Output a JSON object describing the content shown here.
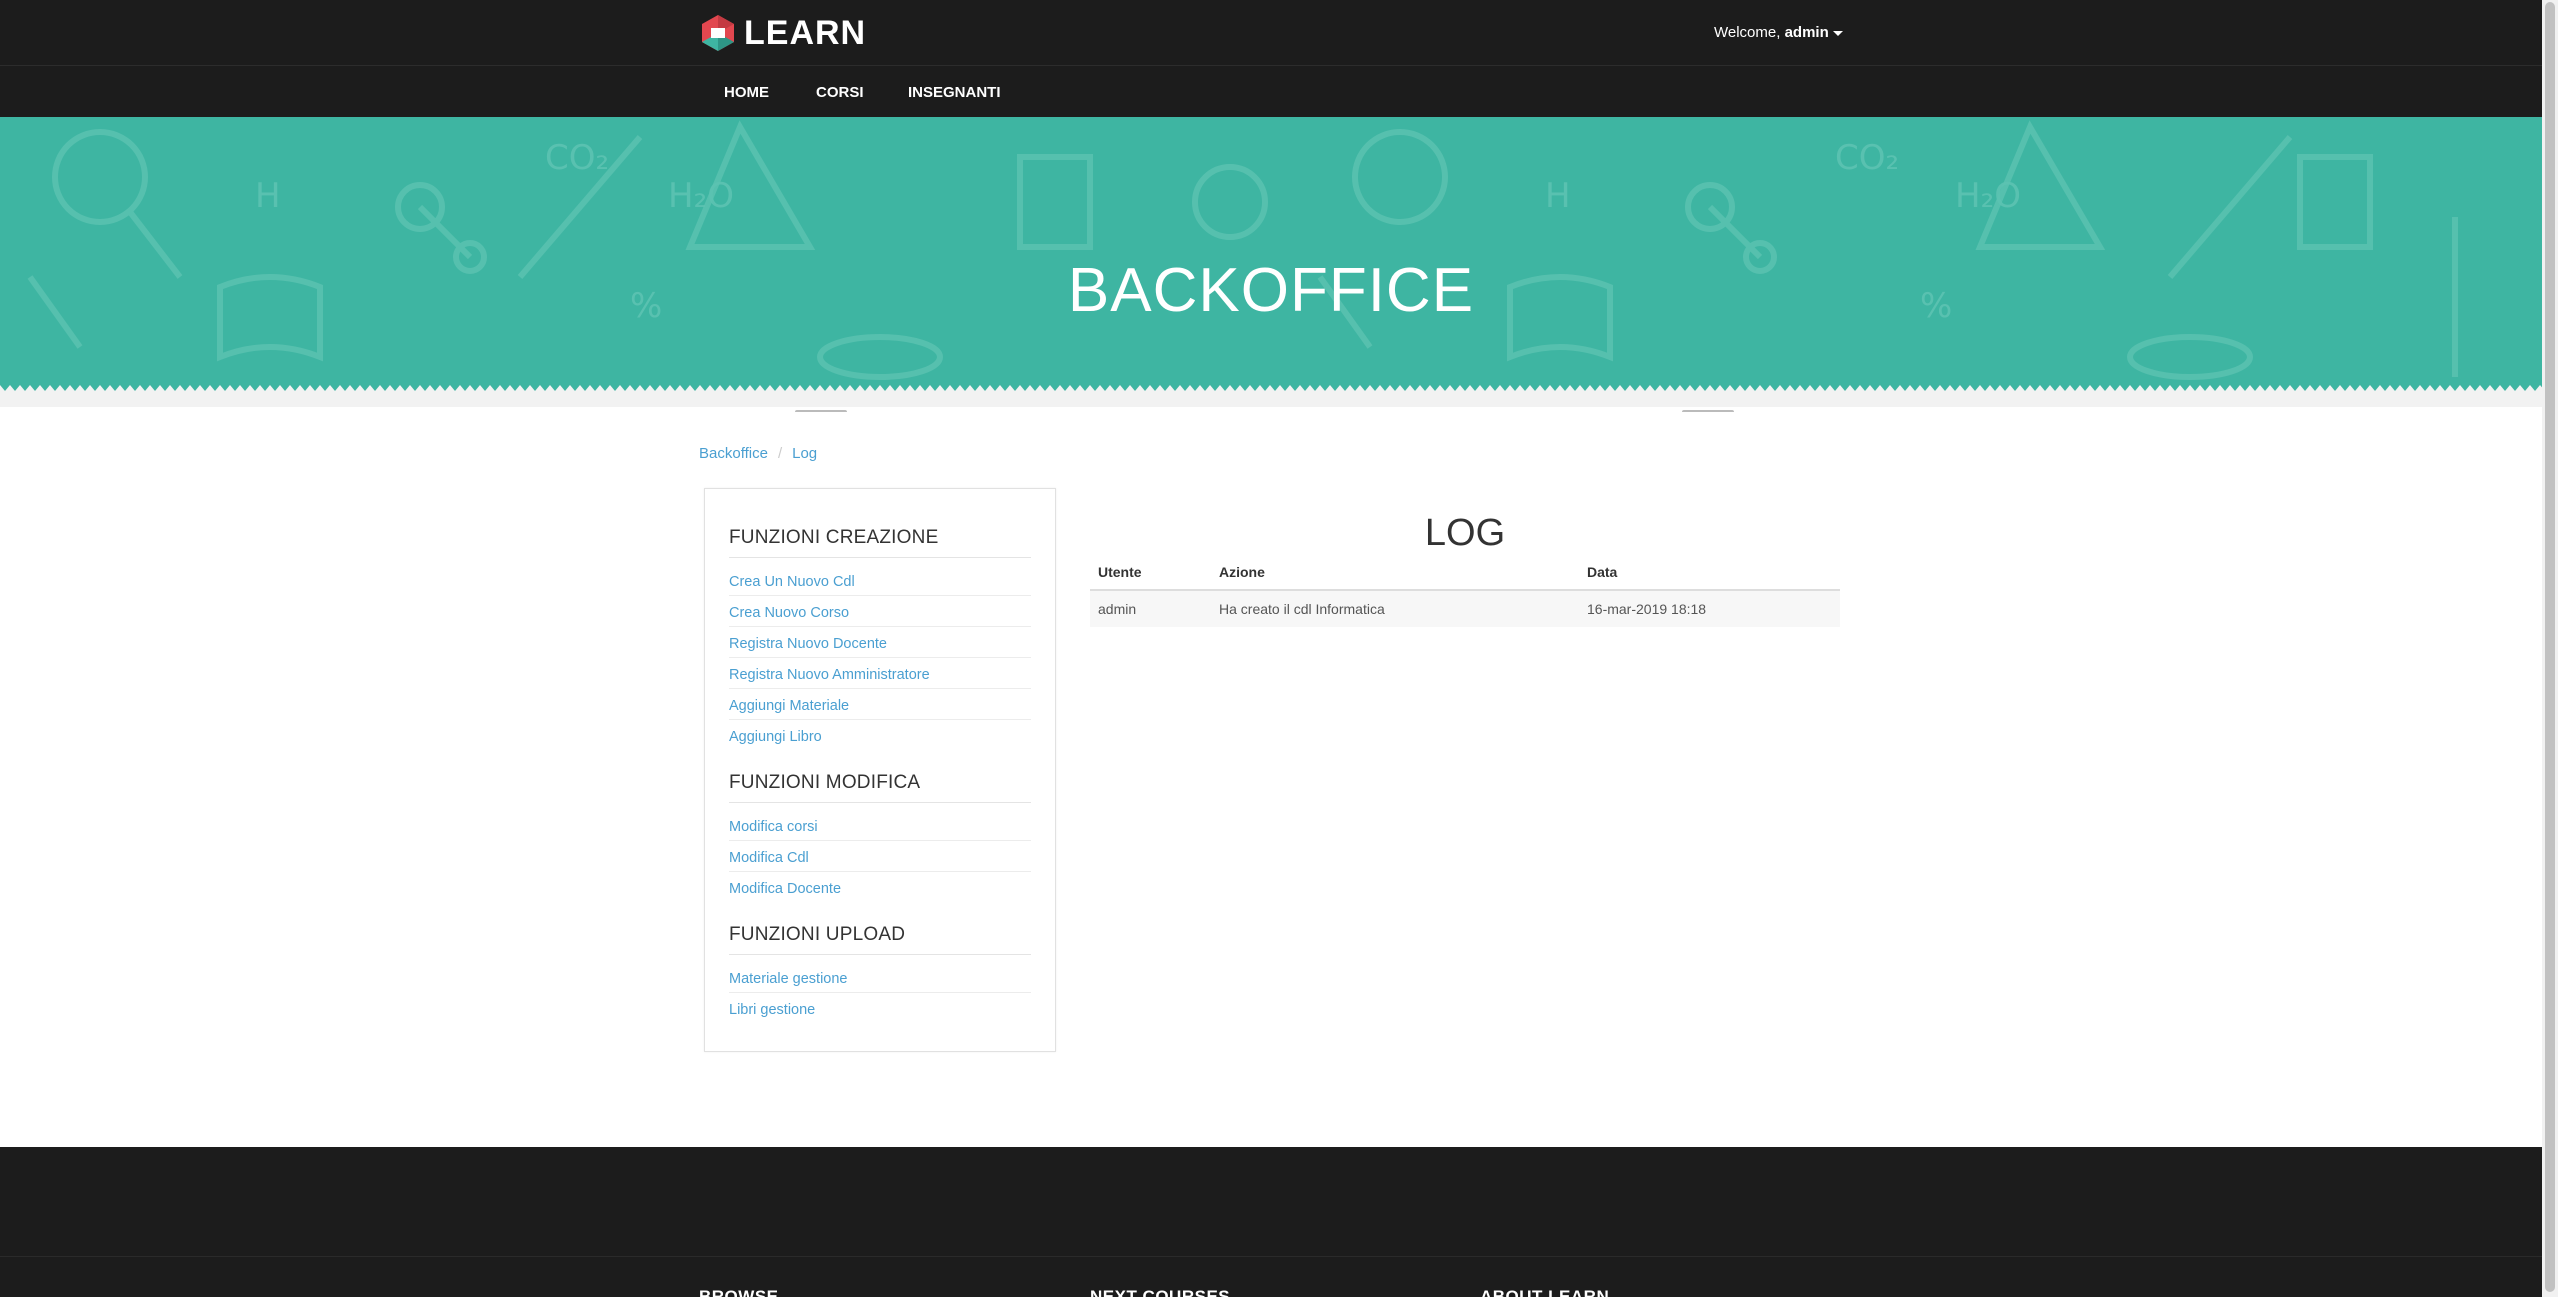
{
  "header": {
    "logo_text": "LEARN",
    "welcome_prefix": "Welcome,",
    "username": "admin",
    "nav": [
      "HOME",
      "CORSI",
      "INSEGNANTI"
    ]
  },
  "hero": {
    "title": "BACKOFFICE"
  },
  "breadcrumb": [
    "Backoffice",
    "Log"
  ],
  "sidebar": {
    "sections": [
      {
        "title": "FUNZIONI CREAZIONE",
        "links": [
          "Crea Un Nuovo Cdl",
          "Crea Nuovo Corso",
          "Registra Nuovo Docente",
          "Registra Nuovo Amministratore",
          "Aggiungi Materiale",
          "Aggiungi Libro"
        ]
      },
      {
        "title": "FUNZIONI MODIFICA",
        "links": [
          "Modifica corsi",
          "Modifica Cdl",
          "Modifica Docente"
        ]
      },
      {
        "title": "FUNZIONI UPLOAD",
        "links": [
          "Materiale gestione",
          "Libri gestione"
        ]
      }
    ]
  },
  "main": {
    "title": "LOG",
    "columns": [
      "Utente",
      "Azione",
      "Data"
    ],
    "rows": [
      [
        "admin",
        "Ha creato il cdl Informatica",
        "16-mar-2019 18:18"
      ]
    ]
  },
  "footer": {
    "headings": [
      "BROWSE",
      "NEXT COURSES",
      "ABOUT LEARN"
    ]
  },
  "colors": {
    "topbar": "#1c1c1c",
    "hero": "#3eb5a2",
    "link": "#4a9fd1",
    "logo_red": "#e2474f",
    "logo_teal": "#3eb5a2"
  },
  "icons": [
    "learn-logo-icon",
    "caret-down-icon"
  ]
}
